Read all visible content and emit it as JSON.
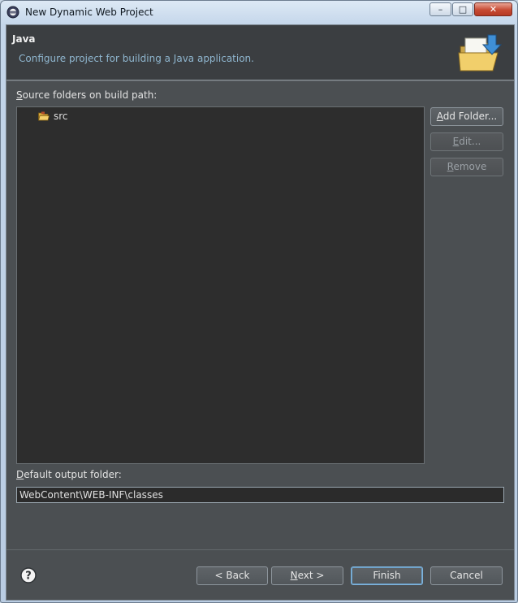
{
  "window": {
    "title": "New Dynamic Web Project",
    "controls": {
      "minimize": "–",
      "maximize": "□",
      "close": "✕"
    }
  },
  "header": {
    "title": "Java",
    "description": "Configure project for building a Java application.",
    "icon": "folder-wizard-icon"
  },
  "source": {
    "label_prefix": "",
    "label_mnemonic": "S",
    "label_rest": "ource folders on build path:",
    "items": [
      {
        "label": "src",
        "icon": "source-folder-icon"
      }
    ]
  },
  "side_buttons": {
    "add_folder": {
      "mnemonic": "A",
      "rest": "dd Folder..."
    },
    "edit": {
      "mnemonic": "E",
      "rest": "dit..."
    },
    "remove": {
      "mnemonic": "R",
      "rest": "emove"
    }
  },
  "output": {
    "label_mnemonic": "D",
    "label_rest": "efault output folder:",
    "value": "WebContent\\WEB-INF\\classes"
  },
  "footer": {
    "help_icon": "help-icon",
    "back": "< Back",
    "next_mnemonic": "N",
    "next_rest": "ext >",
    "finish": "Finish",
    "cancel": "Cancel"
  }
}
